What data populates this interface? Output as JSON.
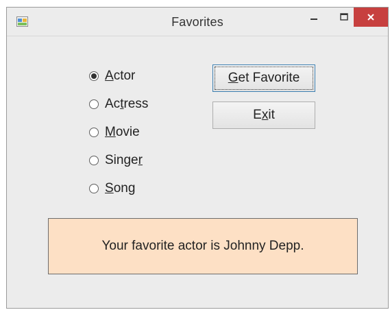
{
  "window": {
    "title": "Favorites",
    "controls": {
      "minimize": "minimize",
      "maximize": "maximize",
      "close": "close"
    }
  },
  "radios": [
    {
      "pre": "",
      "key": "A",
      "post": "ctor",
      "checked": true
    },
    {
      "pre": "Ac",
      "key": "t",
      "post": "ress",
      "checked": false
    },
    {
      "pre": "",
      "key": "M",
      "post": "ovie",
      "checked": false
    },
    {
      "pre": "Singe",
      "key": "r",
      "post": "",
      "checked": false
    },
    {
      "pre": "",
      "key": "S",
      "post": "ong",
      "checked": false
    }
  ],
  "buttons": {
    "get_favorite": {
      "pre": "",
      "key": "G",
      "post": "et Favorite"
    },
    "exit": {
      "pre": "E",
      "key": "x",
      "post": "it"
    }
  },
  "message": "Your favorite actor is Johnny Depp.",
  "colors": {
    "close_button": "#c7403f",
    "message_bg": "#fde0c5"
  }
}
